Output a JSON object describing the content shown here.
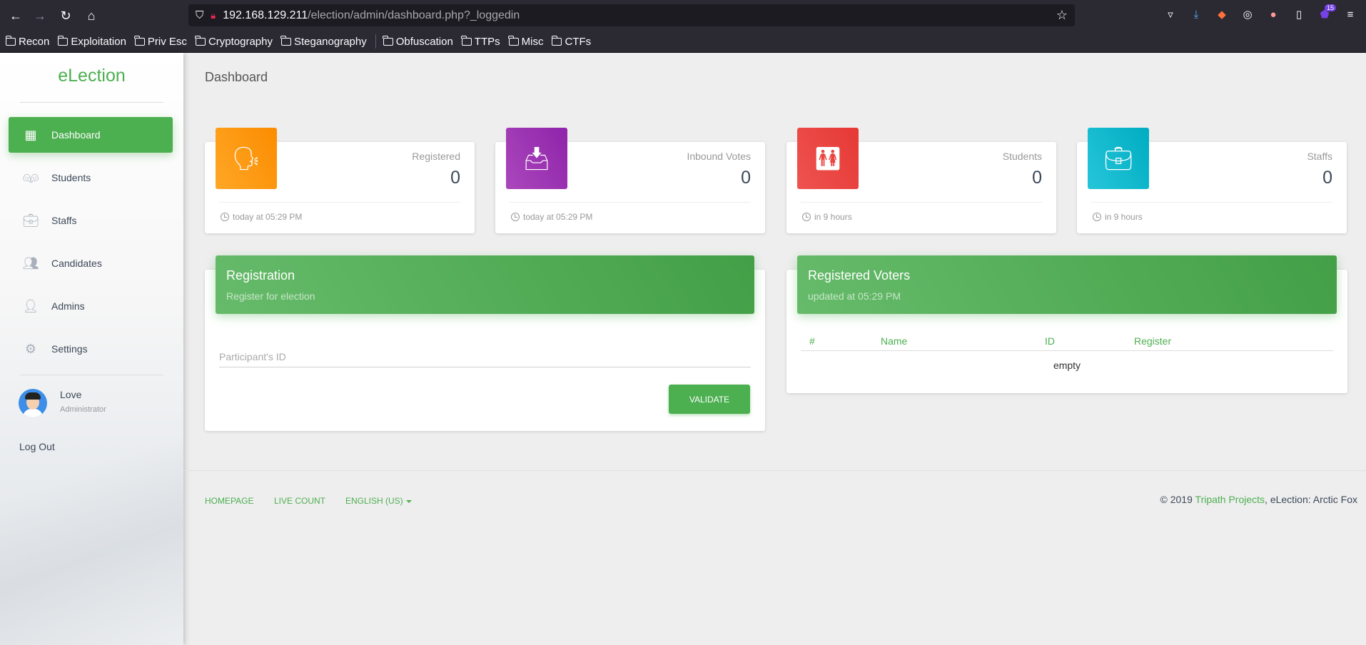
{
  "browser": {
    "url_host": "192.168.129.211",
    "url_path": "/election/admin/dashboard.php?_loggedin",
    "extension_badge": "15",
    "bookmarks": [
      "Recon",
      "Exploitation",
      "Priv Esc",
      "Cryptography",
      "Steganography",
      "Obfuscation",
      "TTPs",
      "Misc",
      "CTFs"
    ]
  },
  "sidebar": {
    "brand": "eLection",
    "items": [
      {
        "label": "Dashboard",
        "icon": "dashboard-icon",
        "active": true
      },
      {
        "label": "Students",
        "icon": "students-icon",
        "active": false
      },
      {
        "label": "Staffs",
        "icon": "briefcase-icon",
        "active": false
      },
      {
        "label": "Candidates",
        "icon": "group-icon",
        "active": false
      },
      {
        "label": "Admins",
        "icon": "person-icon",
        "active": false
      },
      {
        "label": "Settings",
        "icon": "gear-icon",
        "active": false
      }
    ],
    "user": {
      "name": "Love",
      "role": "Administrator"
    },
    "logout": "Log Out"
  },
  "page_title": "Dashboard",
  "stats": [
    {
      "label": "Registered",
      "value": "0",
      "footer": "today at 05:29 PM",
      "color": "#ff9800",
      "icon": "record-voice-icon"
    },
    {
      "label": "Inbound Votes",
      "value": "0",
      "footer": "today at 05:29 PM",
      "color": "#9c27b0",
      "icon": "inbox-icon"
    },
    {
      "label": "Students",
      "value": "0",
      "footer": "in 9 hours",
      "color": "#e53935",
      "icon": "wc-icon"
    },
    {
      "label": "Staffs",
      "value": "0",
      "footer": "in 9 hours",
      "color": "#00bcd4",
      "icon": "briefcase-icon"
    }
  ],
  "registration": {
    "title": "Registration",
    "subtitle": "Register for election",
    "input_placeholder": "Participant's ID",
    "button": "VALIDATE"
  },
  "voters": {
    "title": "Registered Voters",
    "subtitle": "updated at 05:29 PM",
    "columns": [
      "#",
      "Name",
      "ID",
      "Register"
    ],
    "empty_text": "empty"
  },
  "footer": {
    "links": [
      "HOMEPAGE",
      "LIVE COUNT",
      "ENGLISH (US)"
    ],
    "copyright_prefix": "© 2019 ",
    "copyright_link": "Tripath Projects",
    "copyright_suffix": ", eLection: Arctic Fox"
  }
}
